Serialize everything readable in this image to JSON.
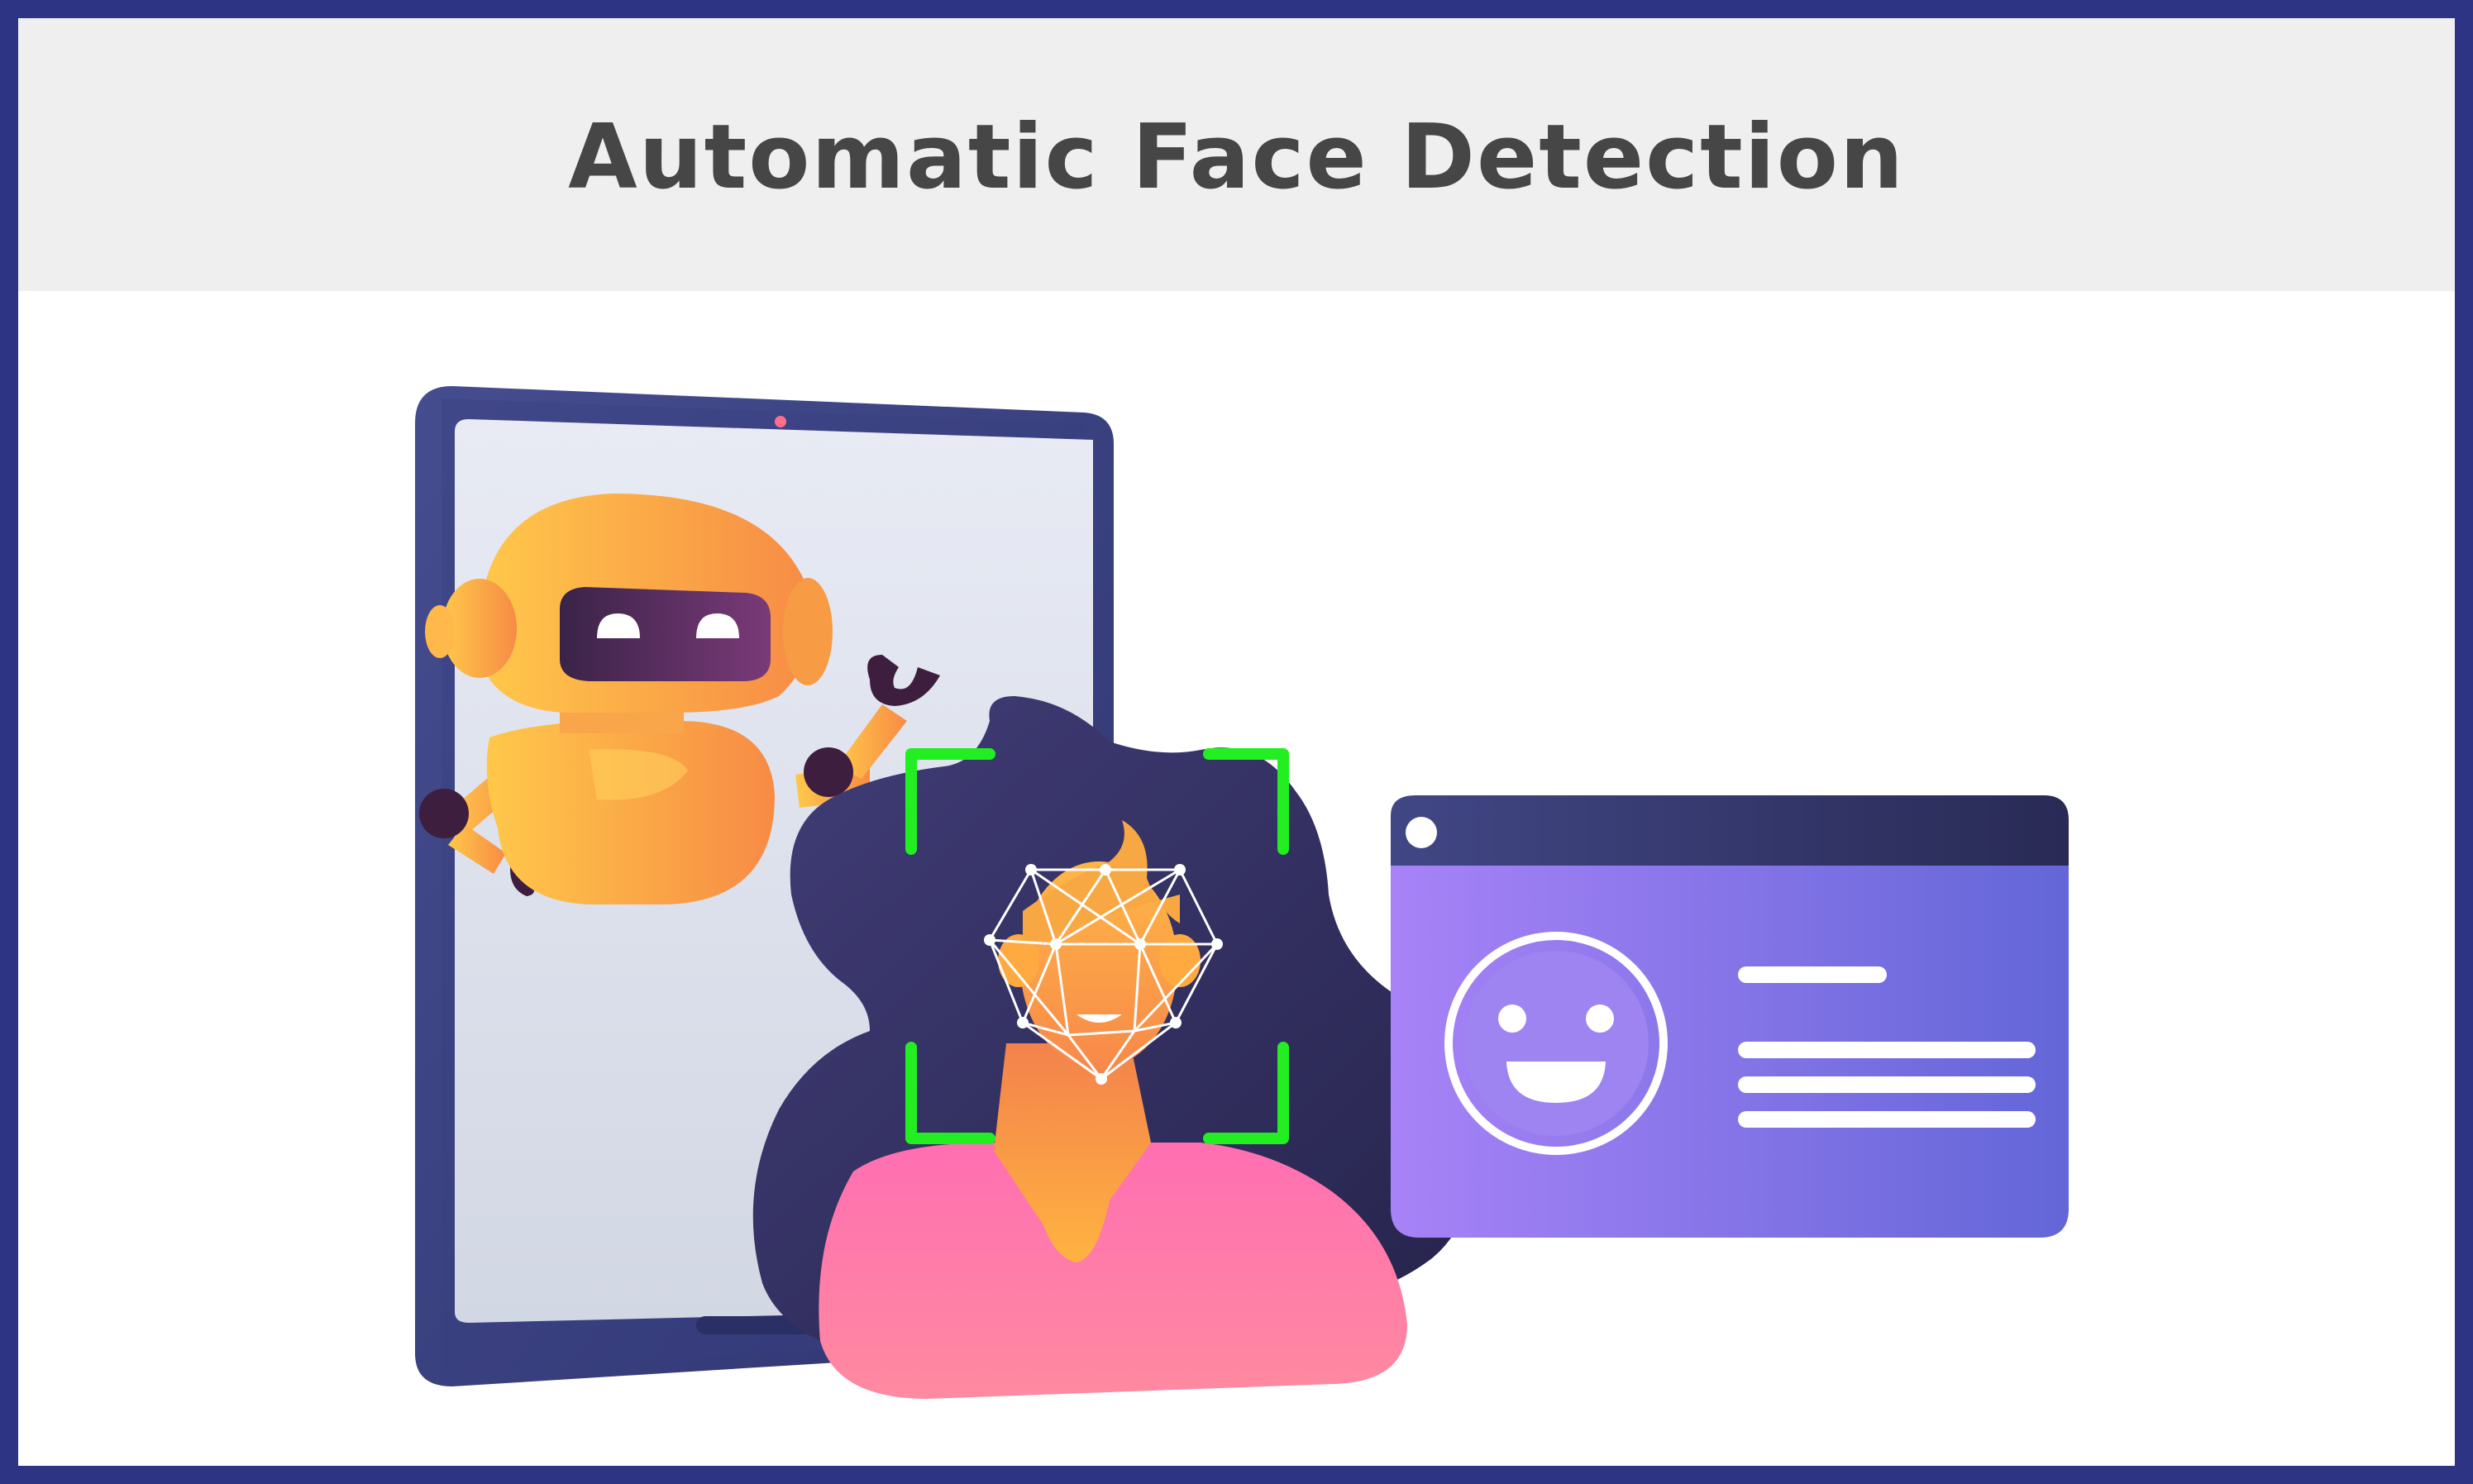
{
  "title": "Automatic Face Detection",
  "colors": {
    "frame_border": "#2d3483",
    "header_bg": "#efefef",
    "title_text": "#464646",
    "detection_bracket": "#22ee22",
    "profile_card_gradient": [
      "#a783f7",
      "#6366d8"
    ],
    "robot_gradient": [
      "#ffc84a",
      "#f78b45"
    ],
    "hair": "#2e2a57",
    "shirt": "#ff7aa8"
  },
  "illustration": {
    "elements": [
      "tablet",
      "robot",
      "woman-portrait",
      "face-mesh-icon",
      "detection-brackets",
      "profile-card",
      "smiley-face-icon"
    ]
  }
}
